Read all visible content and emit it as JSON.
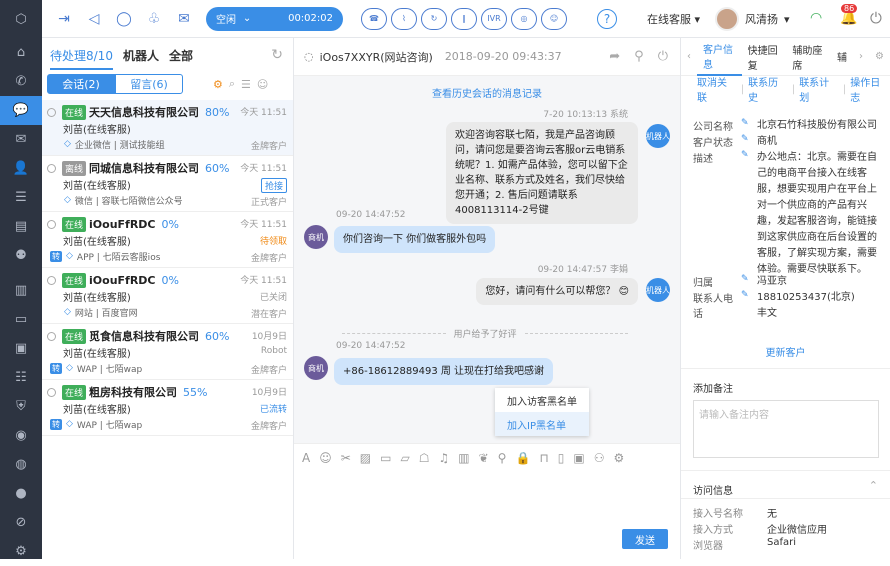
{
  "colors": {
    "accent": "#3a8ee6",
    "online": "#3fae5a",
    "offline": "#9a9a9a",
    "orange": "#f08c1a",
    "nav_bg": "#2d3441"
  },
  "nav": {
    "icons": [
      "logo-icon",
      "home-icon",
      "phone-icon",
      "chat-icon",
      "mail-icon",
      "contact-icon",
      "tasks-icon",
      "book-icon",
      "team-icon",
      "stats-icon",
      "monitor-icon",
      "screen-icon",
      "list-icon",
      "shield-icon",
      "settings-icon",
      "money-icon",
      "message-icon",
      "compass-icon",
      "gear-icon"
    ]
  },
  "topbar": {
    "status_label": "空闲",
    "timer": "00:02:02",
    "call_buttons": [
      "hangup",
      "hold",
      "transfer",
      "pause",
      "IVR",
      "consult",
      "satisfaction"
    ],
    "service_label": "在线客服",
    "user_name": "风清扬",
    "badge": "86"
  },
  "left": {
    "tabs": [
      {
        "label": "待处理8/10"
      },
      {
        "label": "机器人"
      },
      {
        "label": "全部"
      }
    ],
    "segments": [
      "会话(2)",
      "留言(6)"
    ],
    "items": [
      {
        "status": "在线",
        "name": "天天信息科技有限公司",
        "pct": "80%",
        "time": "今天 11:51",
        "agent": "刘苗(在线客服)",
        "state": "",
        "channel": "企业微信 | 测试技能组",
        "ctype": "金牌客户",
        "zhuan": false
      },
      {
        "status": "离线",
        "name": "同城信息科技有限公司",
        "pct": "60%",
        "time": "今天 11:51",
        "agent": "刘苗(在线客服)",
        "state": "抢接",
        "channel": "微信 | 容联七陌微信公众号",
        "ctype": "正式客户",
        "zhuan": false
      },
      {
        "status": "在线",
        "name": "iOouFfRDC",
        "pct": "0%",
        "time": "今天 11:51",
        "agent": "刘苗(在线客服)",
        "state": "待领取",
        "channel": "APP | 七陌云客服ios",
        "ctype": "金牌客户",
        "zhuan": true
      },
      {
        "status": "在线",
        "name": "iOouFfRDC",
        "pct": "0%",
        "time": "今天 11:51",
        "agent": "刘苗(在线客服)",
        "state": "已关闭",
        "channel": "网站 | 百度官网",
        "ctype": "潜在客户",
        "zhuan": false
      },
      {
        "status": "在线",
        "name": "觅食信息科技有限公司",
        "pct": "60%",
        "time": "10月9日",
        "agent": "刘苗(在线客服)",
        "state": "Robot",
        "channel": "WAP | 七陌wap",
        "ctype": "金牌客户",
        "zhuan": true
      },
      {
        "status": "在线",
        "name": "粗房科技有限公司",
        "pct": "55%",
        "time": "10月9日",
        "agent": "刘苗(在线客服)",
        "state": "已流转",
        "channel": "WAP | 七陌wap",
        "ctype": "金牌客户",
        "zhuan": true
      }
    ]
  },
  "chat": {
    "title": "iOos7XXYR(网站咨询)",
    "date": "2018-09-20 09:43:37",
    "history_link": "查看历史会话的消息记录",
    "m1_meta": "7-20  10:13:13  系统",
    "m1": "欢迎咨询容联七陌，我是产品咨询顾问，请问您是要咨询云客服or云电销系统呢？1. 如需产品体验，您可以留下企业名称、联系方式及姓名，我们尽快给您开通；2. 售后问题请联系4008113114-2号键",
    "m2_meta": "09-20  14:47:52",
    "m2_avatar": "商机",
    "m2": "你们咨询一下 你们做客服外包吗",
    "m3_meta": "09-20  14:47:57  李娟",
    "m3": "您好，请问有什么可以帮您？ 😊",
    "divider": "用户给予了好评",
    "m4_meta": "09-20  14:47:52",
    "m4_avatar": "商机",
    "m4": "+86-18612889493 周 让现在打给我吧感谢",
    "bot_label": "机器人",
    "menu": [
      "加入访客黑名单",
      "加入IP黑名单"
    ],
    "send": "发送"
  },
  "right": {
    "tabs": [
      "客户信息",
      "快捷回复",
      "辅助座席",
      "辅"
    ],
    "actions": [
      "取消关联",
      "联系历史",
      "联系计划",
      "操作日志"
    ],
    "fields": [
      {
        "k": "公司名称",
        "v": "北京石竹科技股份有限公司"
      },
      {
        "k": "客户状态",
        "v": "商机"
      },
      {
        "k": "描述",
        "v": "办公地点：北京。需要在自己的电商平台接入在线客服，想要实现用户在平台上对一个供应商的产品有兴趣，发起客服咨询，能链接到这家供应商在后台设置的客服，了解实现方案，需要体验。需要尽快联系下。"
      },
      {
        "k": "归属",
        "v": "冯亚京"
      },
      {
        "k": "联系人电话",
        "v": "18810253437(北京)"
      },
      {
        "k": "",
        "v": "丰文"
      }
    ],
    "update": "更新客户",
    "note_title": "添加备注",
    "note_placeholder": "请输入备注内容",
    "visit_title": "访问信息",
    "visit": [
      {
        "k": "接入号名称",
        "v": "无"
      },
      {
        "k": "接入方式",
        "v": "企业微信应用"
      },
      {
        "k": "浏览器",
        "v": "Safari"
      }
    ]
  }
}
